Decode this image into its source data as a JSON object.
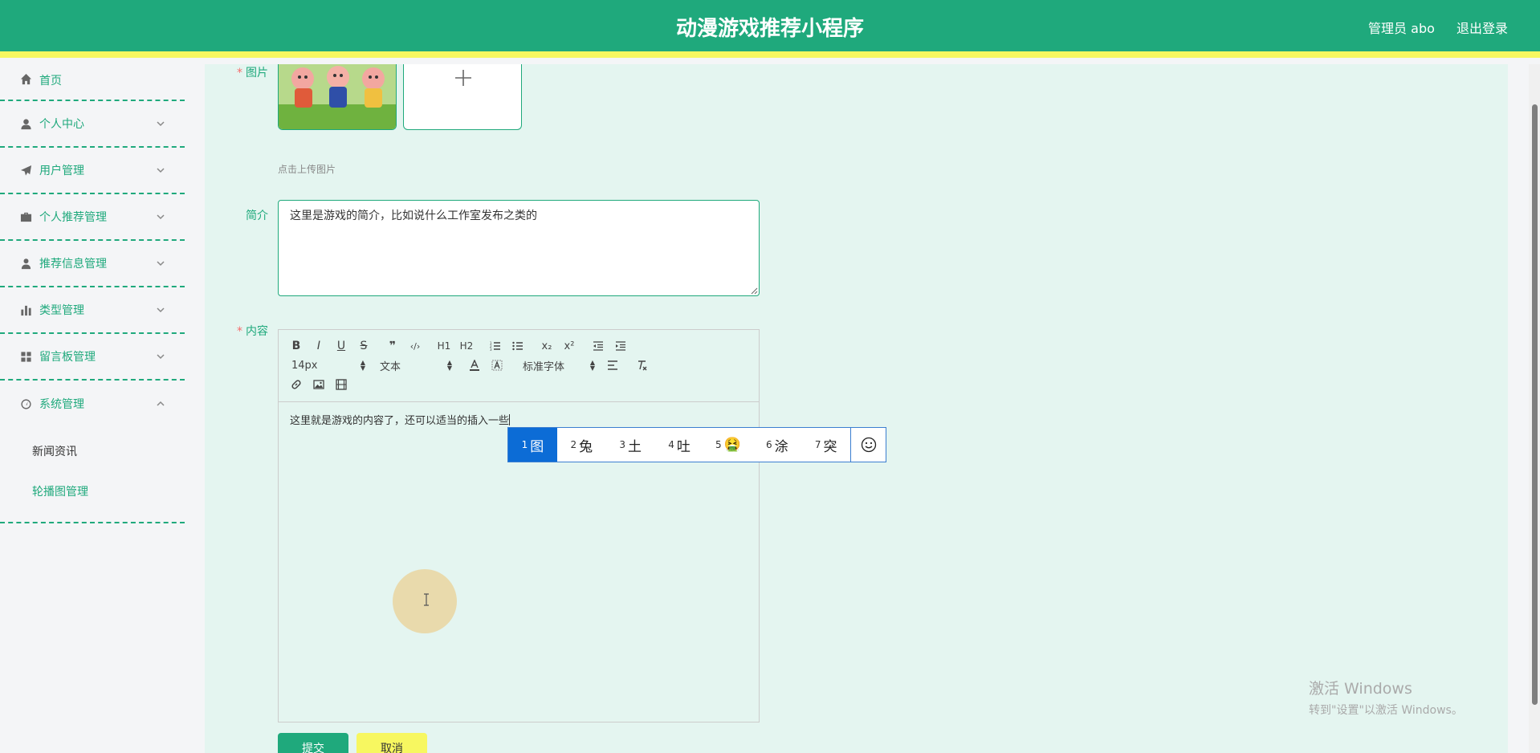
{
  "header": {
    "title": "动漫游戏推荐小程序",
    "user": "管理员 abo",
    "logout": "退出登录"
  },
  "sidebar": {
    "items": [
      {
        "label": "首页",
        "icon": "home-icon"
      },
      {
        "label": "个人中心",
        "icon": "user-icon"
      },
      {
        "label": "用户管理",
        "icon": "paper-plane-icon"
      },
      {
        "label": "个人推荐管理",
        "icon": "briefcase-icon"
      },
      {
        "label": "推荐信息管理",
        "icon": "person-icon"
      },
      {
        "label": "类型管理",
        "icon": "bar-chart-icon"
      },
      {
        "label": "留言板管理",
        "icon": "grid-icon"
      },
      {
        "label": "系统管理",
        "icon": "gauge-icon"
      }
    ],
    "submenu": [
      "新闻资讯",
      "轮播图管理"
    ]
  },
  "form": {
    "image_label": "图片",
    "upload_hint": "点击上传图片",
    "summary_label": "简介",
    "summary_value": "这里是游戏的简介，比如说什么工作室发布之类的",
    "content_label": "内容",
    "content_value": "这里就是游戏的内容了，还可以适当的插入一些",
    "submit": "提交",
    "cancel": "取消"
  },
  "editor": {
    "toolbar_row1": [
      "B",
      "I",
      "U",
      "S",
      "❞",
      "‹/›",
      "H1",
      "H2",
      "ol",
      "ul",
      "x₂",
      "x²",
      "outdent",
      "indent"
    ],
    "font_size": "14px",
    "block_type": "文本",
    "font_family": "标准字体"
  },
  "ime": {
    "candidates": [
      {
        "num": "1",
        "text": "图"
      },
      {
        "num": "2",
        "text": "兔"
      },
      {
        "num": "3",
        "text": "土"
      },
      {
        "num": "4",
        "text": "吐"
      },
      {
        "num": "5",
        "text": "🤮"
      },
      {
        "num": "6",
        "text": "涂"
      },
      {
        "num": "7",
        "text": "突"
      }
    ]
  },
  "watermark": {
    "line1": "激活 Windows",
    "line2": "转到\"设置\"以激活 Windows。"
  },
  "colors": {
    "primary": "#1fa97c",
    "accent": "#f7f760",
    "main_bg": "#e4f5f0",
    "ime_selected": "#0c6cd6"
  }
}
